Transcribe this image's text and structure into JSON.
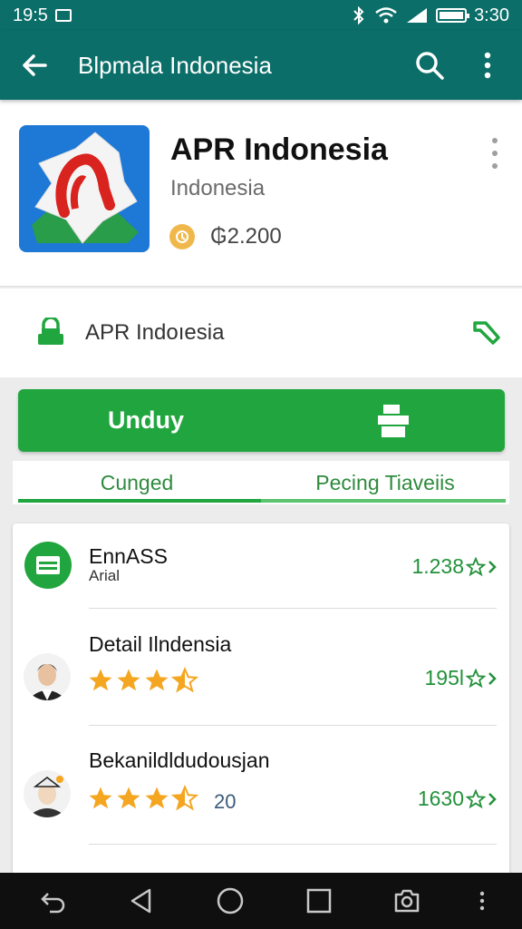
{
  "status_bar": {
    "time_left": "19:5",
    "time_right": "3:30"
  },
  "app_bar": {
    "title": "Blpmala Indonesia",
    "back_icon": "arrow-back-icon",
    "search_icon": "search-icon",
    "more_icon": "more-vert-icon"
  },
  "app": {
    "name": "APR Indonesia",
    "subtitle": "Indonesia",
    "price": "₲2.200",
    "price_icon": "coin-icon"
  },
  "developer": {
    "name": "APR Indoıesia"
  },
  "install": {
    "label": "Unduy"
  },
  "tabs": [
    {
      "label": "Cunged",
      "active": true
    },
    {
      "label": "Pecing Tiaveiis",
      "active": false
    }
  ],
  "list": [
    {
      "title": "EnnASS",
      "subtitle": "Arial",
      "value": "1.238"
    },
    {
      "title": "Detail Ilndensia",
      "rating": 3.5,
      "value": "195l"
    },
    {
      "title": "Bekanildldudousjan",
      "rating": 3.5,
      "count": "20",
      "value": "1630"
    }
  ],
  "colors": {
    "primary": "#0b6e69",
    "accent": "#21a63f",
    "star": "#f4a621"
  }
}
